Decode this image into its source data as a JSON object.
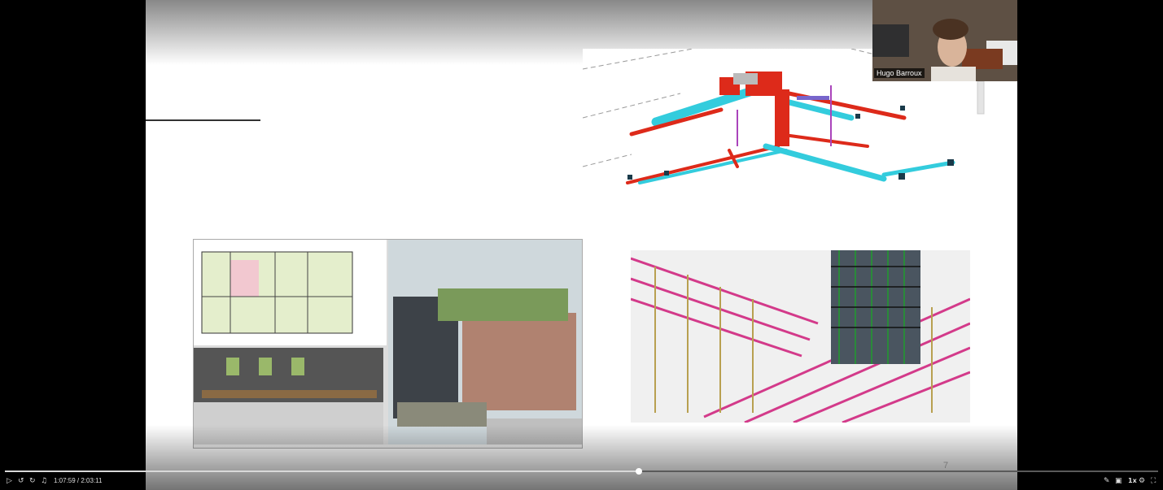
{
  "slide": {
    "page_number": "7"
  },
  "webcam": {
    "participant_name": "Hugo Barroux"
  },
  "player": {
    "current_time": "1:07:59",
    "separator": " / ",
    "total_time": "2:03:11",
    "progress_fraction": 0.55,
    "speed_label": "1x",
    "icons": [
      "play-icon",
      "rewind-icon",
      "forward-icon",
      "volume-icon",
      "subtitles-icon",
      "screen-icon",
      "settings-icon",
      "fullscreen-icon"
    ]
  }
}
